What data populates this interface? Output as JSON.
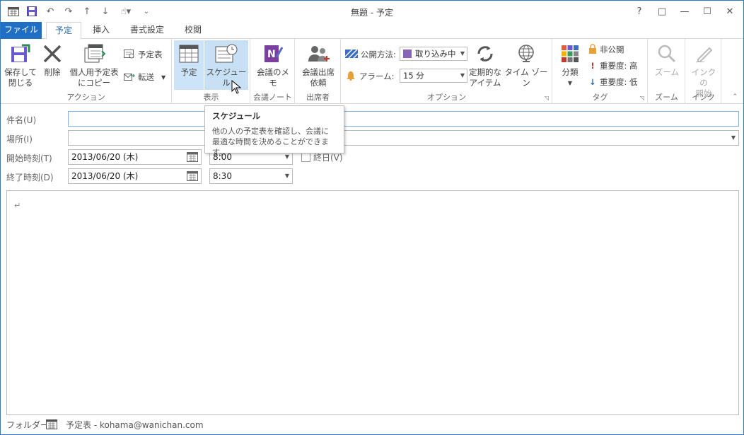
{
  "window": {
    "title": "無題 - 予定"
  },
  "quick_access": [
    "calendar-icon",
    "save-icon",
    "undo-icon",
    "redo-icon",
    "up-arrow-icon",
    "down-arrow-icon",
    "touch-mode-icon",
    "customize-icon"
  ],
  "window_controls": {
    "help": "?",
    "restore_ribbon": "□",
    "minimize": "—",
    "maximize": "☐",
    "close": "✕"
  },
  "tabs": {
    "file": "ファイル",
    "appointment": "予定",
    "insert": "挿入",
    "format": "書式設定",
    "review": "校閲"
  },
  "ribbon": {
    "actions": {
      "save_close_1": "保存して",
      "save_close_2": "閉じる",
      "delete": "削除",
      "copy_1": "個人用予定表",
      "copy_2": "にコピー",
      "calendar": "予定表",
      "forward": "転送",
      "group_label": "アクション"
    },
    "show": {
      "appointment": "予定",
      "schedule": "スケジュール",
      "group_label": "表示"
    },
    "meeting_notes": {
      "notes": "会議のメモ",
      "group_label": "会議ノート"
    },
    "attendees": {
      "invite_1": "会議出席",
      "invite_2": "依頼",
      "group_label": "出席者"
    },
    "options": {
      "show_as_label": "公開方法:",
      "show_as_value": "取り込み中",
      "reminder_label": "アラーム:",
      "reminder_value": "15 分",
      "recurrence_1": "定期的な",
      "recurrence_2": "アイテム",
      "timezones": "タイム ゾーン",
      "group_label": "オプション"
    },
    "tags": {
      "categorize": "分類",
      "private": "非公開",
      "high_importance": "重要度: 高",
      "low_importance": "重要度: 低",
      "group_label": "タグ"
    },
    "zoom": {
      "zoom": "ズーム",
      "group_label": "ズーム"
    },
    "ink": {
      "start_1": "インクの",
      "start_2": "開始",
      "group_label": "インク"
    }
  },
  "tooltip": {
    "title": "スケジュール",
    "line1": "他の人の予定表を確認し、会議に",
    "line2": "最適な時間を決めることができます。"
  },
  "form": {
    "subject_label": "件名(U)",
    "subject_value": "",
    "location_label": "場所(I)",
    "location_value": "",
    "start_label": "開始時刻(T)",
    "start_date": "2013/06/20 (木)",
    "start_time": "8:00",
    "allday_label": "終日(V)",
    "end_label": "終了時刻(D)",
    "end_date": "2013/06/20 (木)",
    "end_time": "8:30",
    "body_mark": "↵"
  },
  "status_bar": {
    "folder_label": "フォルダー",
    "folder_value": "予定表 - kohama@wanichan.com"
  },
  "colors": {
    "accent": "#1f6fc5",
    "selected": "#cde3f7",
    "busy": "#8764b8"
  }
}
